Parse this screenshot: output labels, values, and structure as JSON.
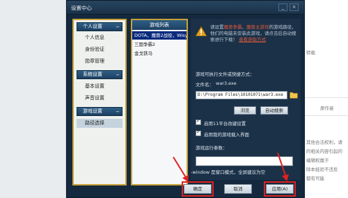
{
  "background": {
    "right_text": [
      "转载",
      "原作者",
      "其他合法权利，请",
      "的相关内容引起的",
      "编辑权属于",
      "除本经验不违反",
      "都有可能"
    ]
  },
  "dialog": {
    "title": "设置中心",
    "minimize_label": "_",
    "close_label": "×",
    "categories": [
      {
        "label": "个人设置",
        "toggle": "−",
        "items": [
          "个人信息",
          "身份验证",
          "勋章管理"
        ]
      },
      {
        "label": "系统设置",
        "toggle": "−",
        "items": [
          "基本设置",
          "声音设置"
        ]
      },
      {
        "label": "游戏设置",
        "toggle": "−",
        "items": [
          "路径选择"
        ]
      }
    ],
    "game_list": {
      "header": "游戏列表",
      "items": [
        "DOTA，魔兽2战役，Wisys",
        "三国争霸2",
        "金戈铁马"
      ]
    },
    "settings": {
      "notice_part1": "请设置",
      "notice_red1": "魔兽争霸",
      "notice_part2": "、",
      "notice_red2": "魔兽主游戏",
      "notice_part3": "的游戏路径，他们的电脑未安装此游戏，请点击后自动搜索进行下载！",
      "notice_link": "查看获取方式",
      "exe_section_label": "游戏可执行文件或快捷方式：",
      "filename_label": "文件名：",
      "filename_value": "war3.exe",
      "path_value": "D:\\Program Files\\10101071\\war3.exe",
      "browse_label": "浏览",
      "auto_search_label": "自动搜索",
      "checkbox1_label": "启用11平台改键设置",
      "checkbox2_label": "启用我的游戏载入界面",
      "params_label": "游戏运行参数：",
      "params_value": "",
      "window_note": "-window 是窗口模式，全屏建议为空"
    },
    "buttons": {
      "ok": "确定",
      "cancel": "取消",
      "apply": "应用(A)"
    }
  }
}
